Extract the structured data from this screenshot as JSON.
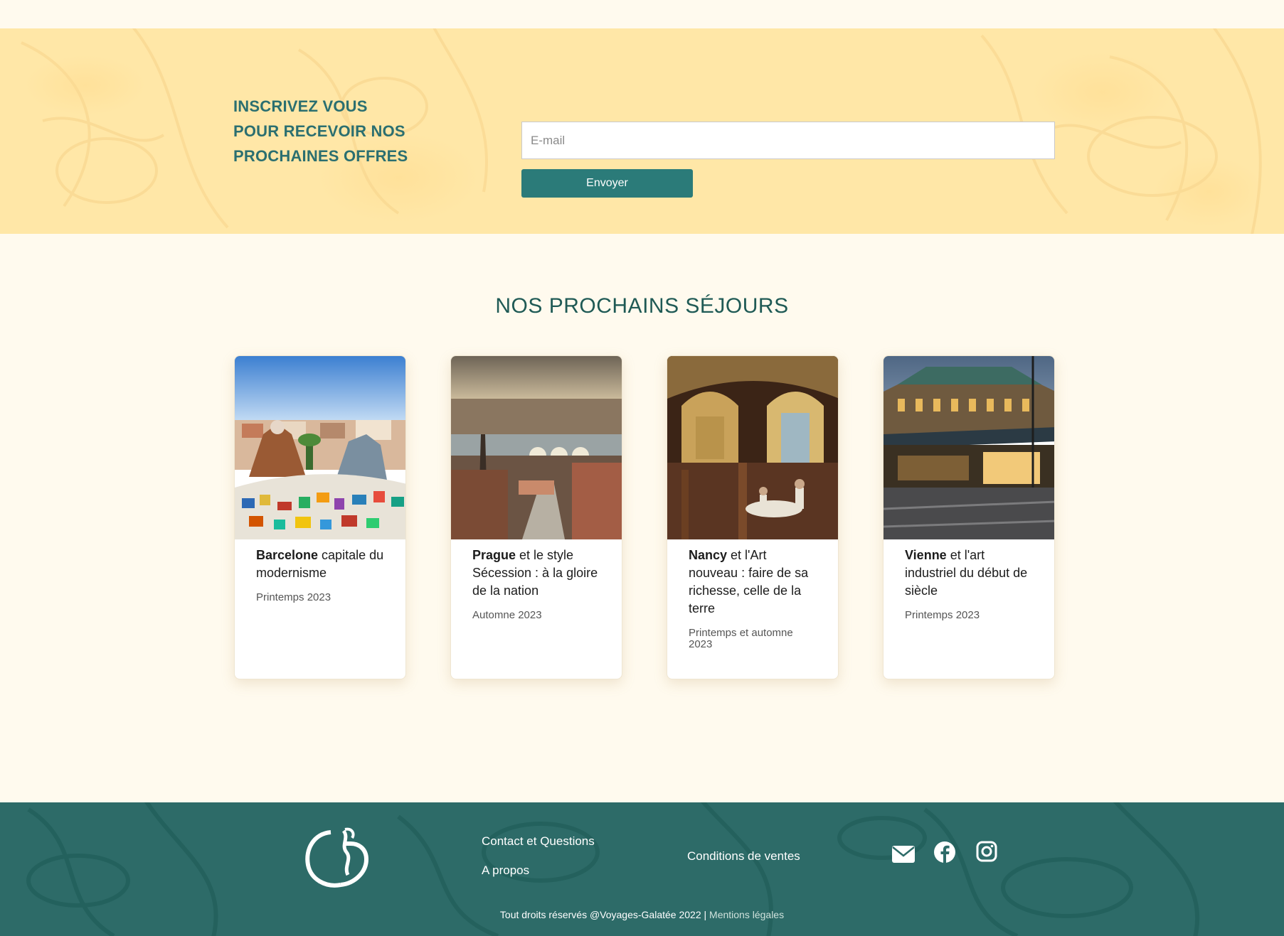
{
  "newsletter": {
    "heading": "INSCRIVEZ VOUS\nPOUR RECEVOIR NOS\nPROCHAINES OFFRES",
    "email_placeholder": "E-mail",
    "email_value": "",
    "submit_label": "Envoyer"
  },
  "trips": {
    "section_title": "NOS PROCHAINS SÉJOURS",
    "items": [
      {
        "city": "Barcelone",
        "title_rest": " capitale du modernisme",
        "date": "Printemps 2023",
        "image": "barcelona-park-guell-photo"
      },
      {
        "city": "Prague",
        "title_rest": " et le style Sécession : à la gloire de la nation",
        "date": "Automne 2023",
        "image": "prague-cityscape-photo"
      },
      {
        "city": "Nancy",
        "title_rest": " et l'Art nouveau : faire de sa richesse, celle de la terre",
        "date": "Printemps et automne 2023",
        "image": "nancy-art-nouveau-restaurant-photo"
      },
      {
        "city": "Vienne",
        "title_rest": " et l'art industriel du début de siècle",
        "date": "Printemps 2023",
        "image": "vienna-opera-station-photo"
      }
    ]
  },
  "footer": {
    "links": {
      "contact": "Contact et Questions",
      "about": "A propos",
      "terms": "Conditions de ventes"
    },
    "social_icons": [
      "mail-icon",
      "facebook-icon",
      "instagram-icon"
    ],
    "copyright": "Tout droits réservés @Voyages-Galatée 2022 |",
    "legal": " Mentions légales"
  },
  "colors": {
    "accent": "#2b7b79",
    "newsletter_bg": "#ffe7a7",
    "page_bg": "#fffaee",
    "footer_bg": "#2d6b68",
    "title": "#1f5a55"
  }
}
